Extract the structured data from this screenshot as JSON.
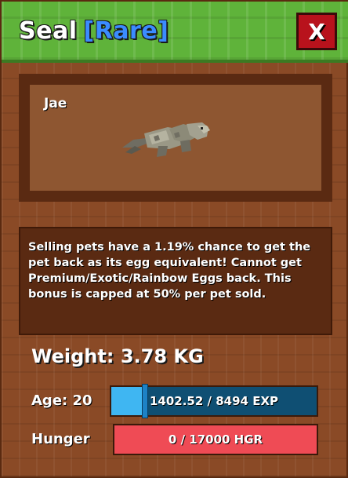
{
  "header": {
    "pet_name": "Seal",
    "rarity": "[Rare]",
    "close_label": "X",
    "rarity_color": "#3b8cff",
    "close_color": "#b8121c"
  },
  "pet_preview": {
    "nickname": "Jae"
  },
  "description": "Selling pets have a 1.19% chance to get the pet back as its egg equivalent! Cannot get Premium/Exotic/Rainbow Eggs back. This bonus is capped at 50% per pet sold.",
  "stats": {
    "weight_text": "Weight: 3.78 KG",
    "age_text": "Age: 20",
    "exp": {
      "text": "1402.52 / 8494 EXP",
      "current": 1402.52,
      "max": 8494
    },
    "hunger_label": "Hunger",
    "hunger": {
      "text": "0 / 17000 HGR",
      "current": 0,
      "max": 17000
    }
  }
}
